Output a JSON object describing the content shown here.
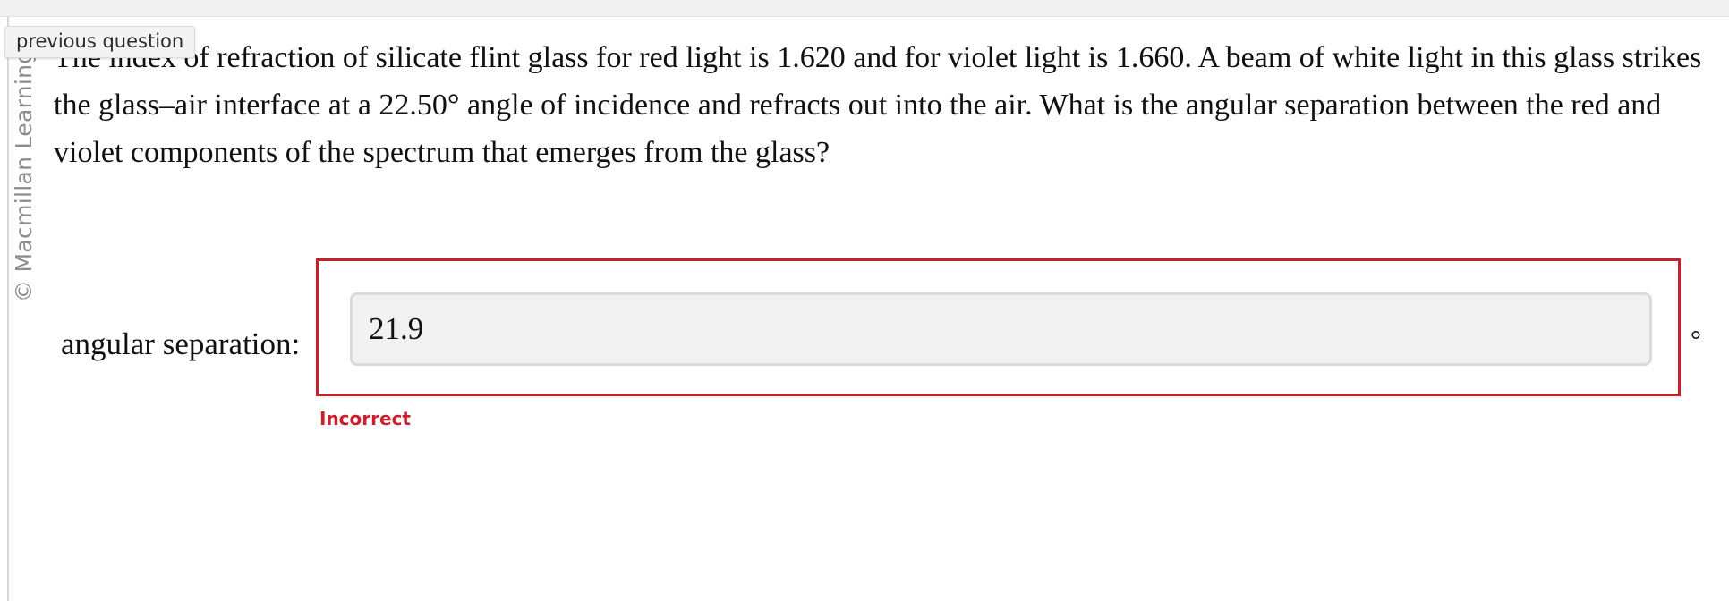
{
  "tooltip": {
    "previous_question": "previous question"
  },
  "watermark": {
    "text": "© Macmillan Learning"
  },
  "question": {
    "text": "The index of refraction of silicate flint glass for red light is 1.620 and for violet light is 1.660. A beam of white light in this glass strikes the glass–air interface at a 22.50° angle of incidence and refracts out into the air. What is the angular separation between the red and violet components of the spectrum that emerges from the glass?"
  },
  "answer": {
    "label": "angular separation:",
    "value": "21.9",
    "unit": "°",
    "status": "Incorrect"
  },
  "colors": {
    "error": "#cc1f2d",
    "input_background": "#f2f2f2"
  }
}
